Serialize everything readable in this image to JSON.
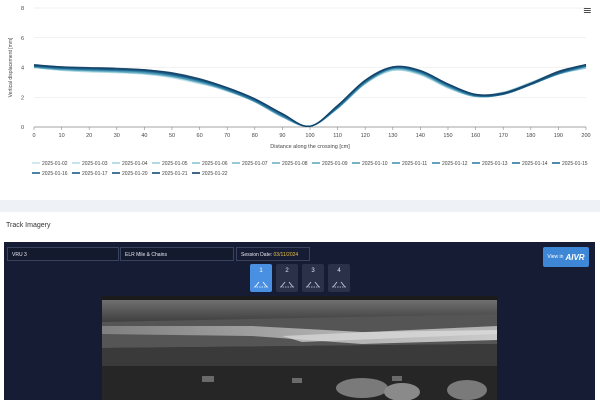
{
  "chart_data": {
    "type": "line",
    "title": "",
    "xlabel": "Distance along the crossing [cm]",
    "ylabel": "Vertical displacement [mm]",
    "xlim": [
      0,
      200
    ],
    "ylim": [
      0,
      8
    ],
    "xticks": [
      0,
      10,
      20,
      30,
      40,
      50,
      60,
      70,
      80,
      90,
      100,
      110,
      120,
      130,
      140,
      150,
      160,
      170,
      180,
      190,
      200
    ],
    "yticks": [
      0,
      2,
      4,
      6,
      8
    ],
    "grid": "horizontal",
    "legend_placement": "bottom",
    "x": [
      0,
      10,
      20,
      30,
      40,
      50,
      60,
      70,
      80,
      90,
      100,
      110,
      120,
      130,
      140,
      150,
      160,
      170,
      180,
      190,
      200
    ],
    "series": [
      {
        "name": "2025-01-02",
        "color": "#c4e3ea",
        "values": [
          4.0,
          3.8,
          3.7,
          3.65,
          3.55,
          3.3,
          2.9,
          2.5,
          1.8,
          0.8,
          0.1,
          1.4,
          3.0,
          3.85,
          3.5,
          2.6,
          2.05,
          2.25,
          2.9,
          3.55,
          4.0
        ]
      },
      {
        "name": "2025-01-03",
        "color": "#b8dde6",
        "values": [
          4.0,
          3.8,
          3.7,
          3.65,
          3.55,
          3.35,
          2.95,
          2.45,
          1.75,
          0.7,
          0.05,
          1.3,
          2.95,
          3.8,
          3.5,
          2.65,
          2.1,
          2.3,
          2.95,
          3.6,
          4.05
        ]
      },
      {
        "name": "2025-01-04",
        "color": "#a9d5e0",
        "values": [
          4.05,
          3.85,
          3.75,
          3.7,
          3.6,
          3.35,
          2.95,
          2.4,
          1.7,
          0.65,
          0.05,
          1.25,
          2.9,
          3.8,
          3.55,
          2.7,
          2.15,
          2.35,
          3.0,
          3.65,
          4.1
        ]
      },
      {
        "name": "2025-01-05",
        "color": "#9bcedb",
        "values": [
          4.1,
          3.9,
          3.8,
          3.75,
          3.65,
          3.4,
          3.0,
          2.45,
          1.7,
          0.7,
          0.05,
          1.25,
          2.9,
          3.85,
          3.6,
          2.7,
          2.1,
          2.3,
          3.0,
          3.7,
          4.1
        ]
      },
      {
        "name": "2025-01-06",
        "color": "#8cc5d5",
        "values": [
          4.0,
          3.85,
          3.75,
          3.7,
          3.6,
          3.4,
          3.0,
          2.45,
          1.7,
          0.7,
          0.05,
          1.3,
          2.95,
          3.85,
          3.55,
          2.65,
          2.05,
          2.2,
          2.85,
          3.55,
          3.95
        ]
      },
      {
        "name": "2025-01-07",
        "color": "#7dbccf",
        "values": [
          4.05,
          3.9,
          3.8,
          3.75,
          3.65,
          3.45,
          3.05,
          2.5,
          1.75,
          0.75,
          0.05,
          1.3,
          2.95,
          3.9,
          3.6,
          2.7,
          2.1,
          2.25,
          2.9,
          3.6,
          4.0
        ]
      },
      {
        "name": "2025-01-08",
        "color": "#6fb3c9",
        "values": [
          4.1,
          3.9,
          3.8,
          3.7,
          3.6,
          3.4,
          3.0,
          2.5,
          1.8,
          0.75,
          0.05,
          1.35,
          3.0,
          3.9,
          3.6,
          2.7,
          2.05,
          2.2,
          2.85,
          3.6,
          4.05
        ]
      },
      {
        "name": "2025-01-09",
        "color": "#61a9c2",
        "values": [
          4.0,
          3.85,
          3.8,
          3.75,
          3.65,
          3.45,
          3.05,
          2.5,
          1.75,
          0.7,
          0.05,
          1.3,
          3.0,
          3.95,
          3.65,
          2.75,
          2.1,
          2.25,
          2.9,
          3.65,
          4.1
        ]
      },
      {
        "name": "2025-01-10",
        "color": "#549fbb",
        "values": [
          4.05,
          3.9,
          3.8,
          3.75,
          3.65,
          3.4,
          3.0,
          2.45,
          1.7,
          0.7,
          0.05,
          1.25,
          2.95,
          3.9,
          3.6,
          2.7,
          2.05,
          2.2,
          2.85,
          3.55,
          4.05
        ]
      },
      {
        "name": "2025-01-11",
        "color": "#4895b4",
        "values": [
          4.1,
          3.95,
          3.85,
          3.8,
          3.7,
          3.45,
          3.05,
          2.5,
          1.75,
          0.75,
          0.05,
          1.3,
          3.0,
          3.95,
          3.65,
          2.75,
          2.1,
          2.2,
          2.85,
          3.6,
          4.1
        ]
      },
      {
        "name": "2025-01-12",
        "color": "#3d8bad",
        "values": [
          4.05,
          3.9,
          3.85,
          3.8,
          3.7,
          3.5,
          3.1,
          2.55,
          1.8,
          0.8,
          0.05,
          1.35,
          3.05,
          3.95,
          3.65,
          2.75,
          2.1,
          2.2,
          2.85,
          3.6,
          4.1
        ]
      },
      {
        "name": "2025-01-13",
        "color": "#3381a6",
        "values": [
          4.1,
          3.95,
          3.85,
          3.8,
          3.75,
          3.5,
          3.1,
          2.55,
          1.8,
          0.8,
          0.05,
          1.35,
          3.05,
          3.95,
          3.7,
          2.8,
          2.15,
          2.25,
          2.9,
          3.65,
          4.15
        ]
      },
      {
        "name": "2025-01-14",
        "color": "#2b779e",
        "values": [
          4.1,
          3.95,
          3.9,
          3.85,
          3.75,
          3.5,
          3.1,
          2.5,
          1.75,
          0.75,
          0.05,
          1.3,
          3.0,
          3.95,
          3.7,
          2.8,
          2.15,
          2.25,
          2.85,
          3.6,
          4.1
        ]
      },
      {
        "name": "2025-01-15",
        "color": "#246e96",
        "values": [
          4.15,
          4.0,
          3.9,
          3.85,
          3.75,
          3.55,
          3.15,
          2.55,
          1.8,
          0.8,
          0.05,
          1.35,
          3.05,
          4.0,
          3.7,
          2.8,
          2.1,
          2.2,
          2.85,
          3.65,
          4.15
        ]
      },
      {
        "name": "2025-01-16",
        "color": "#1f658d",
        "values": [
          4.1,
          3.95,
          3.9,
          3.85,
          3.8,
          3.55,
          3.15,
          2.6,
          1.85,
          0.85,
          0.05,
          1.4,
          3.1,
          4.0,
          3.75,
          2.85,
          2.15,
          2.2,
          2.85,
          3.6,
          4.1
        ]
      },
      {
        "name": "2025-01-17",
        "color": "#1b5c84",
        "values": [
          4.15,
          4.0,
          3.95,
          3.9,
          3.8,
          3.55,
          3.15,
          2.6,
          1.85,
          0.85,
          0.05,
          1.4,
          3.1,
          4.0,
          3.75,
          2.85,
          2.15,
          2.25,
          2.9,
          3.65,
          4.15
        ]
      },
      {
        "name": "2025-01-20",
        "color": "#18537b",
        "values": [
          4.1,
          4.0,
          3.95,
          3.9,
          3.8,
          3.6,
          3.2,
          2.6,
          1.85,
          0.85,
          0.05,
          1.4,
          3.1,
          4.0,
          3.75,
          2.85,
          2.15,
          2.25,
          2.9,
          3.7,
          4.2
        ]
      },
      {
        "name": "2025-01-21",
        "color": "#154a72",
        "values": [
          4.15,
          4.05,
          3.95,
          3.9,
          3.85,
          3.6,
          3.2,
          2.65,
          1.9,
          0.9,
          0.05,
          1.45,
          3.15,
          4.05,
          3.8,
          2.9,
          2.2,
          2.25,
          2.9,
          3.7,
          4.2
        ]
      },
      {
        "name": "2025-01-22",
        "color": "#123f66",
        "values": [
          4.2,
          4.05,
          4.0,
          3.95,
          3.85,
          3.65,
          3.25,
          2.65,
          1.9,
          0.9,
          0.05,
          1.45,
          3.15,
          4.05,
          3.8,
          2.9,
          2.2,
          2.3,
          2.95,
          3.75,
          4.2
        ]
      }
    ]
  },
  "chart_menu": {
    "icon": "hamburger-menu-icon",
    "glyph": "≡"
  },
  "imagery": {
    "title": "Track Imagery",
    "vru_value": "VRU 3",
    "elr_value": "ELR Mile & Chains",
    "session_label": "Session Date:",
    "session_value": "03/11/2024",
    "aivr_prefix": "View in",
    "aivr_brand": "AIVR",
    "cameras": [
      {
        "label": "1",
        "active": true
      },
      {
        "label": "2",
        "active": false
      },
      {
        "label": "3",
        "active": false
      },
      {
        "label": "4",
        "active": false
      }
    ]
  }
}
